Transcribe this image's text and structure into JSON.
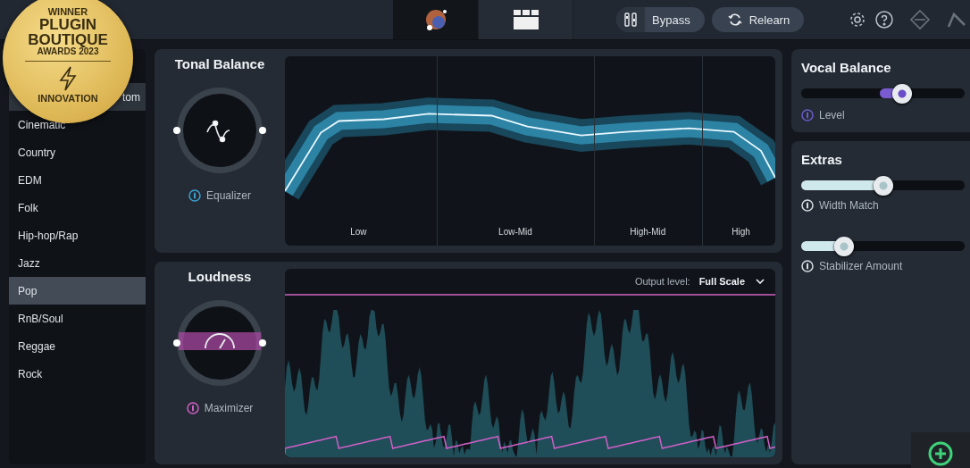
{
  "badge": {
    "lines": [
      "WINNER",
      "PLUGIN",
      "BOUTIQUE",
      "AWARDS 2023"
    ],
    "footer": "INNOVATION"
  },
  "toolbar": {
    "tabs": [
      {
        "kind": "orb",
        "selected": true
      },
      {
        "kind": "grid",
        "selected": false
      }
    ],
    "bypass": {
      "label": "Bypass"
    },
    "relearn": {
      "label": "Relearn"
    }
  },
  "genres": [
    {
      "label": "tom",
      "selected": false,
      "highlighted": true
    },
    {
      "label": "Cinematic",
      "selected": false,
      "highlighted": false
    },
    {
      "label": "Country",
      "selected": false,
      "highlighted": false
    },
    {
      "label": "EDM",
      "selected": false,
      "highlighted": false
    },
    {
      "label": "Folk",
      "selected": false,
      "highlighted": false
    },
    {
      "label": "Hip-hop/Rap",
      "selected": false,
      "highlighted": false
    },
    {
      "label": "Jazz",
      "selected": false,
      "highlighted": false
    },
    {
      "label": "Pop",
      "selected": true,
      "highlighted": false
    },
    {
      "label": "RnB/Soul",
      "selected": false,
      "highlighted": false
    },
    {
      "label": "Reggae",
      "selected": false,
      "highlighted": false
    },
    {
      "label": "Rock",
      "selected": false,
      "highlighted": false
    }
  ],
  "tonal_balance": {
    "title": "Tonal Balance",
    "module": "Equalizer",
    "bands": [
      "Low",
      "Low-Mid",
      "High-Mid",
      "High"
    ]
  },
  "loudness": {
    "title": "Loudness",
    "module": "Maximizer",
    "output_label": "Output level:",
    "output_value": "Full Scale"
  },
  "vocal_balance": {
    "title": "Vocal Balance",
    "slider": {
      "label": "Level",
      "level": 0.62
    }
  },
  "extras": {
    "title": "Extras",
    "sliders": [
      {
        "label": "Width Match",
        "level": 0.5
      },
      {
        "label": "Stabilizer Amount",
        "level": 0.26
      }
    ]
  }
}
